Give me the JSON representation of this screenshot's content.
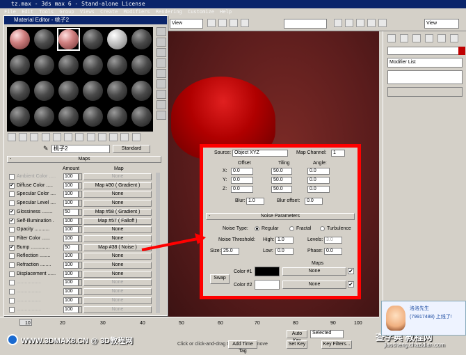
{
  "window": {
    "title": "tz.max - 3ds max 6 - Stand-alone License"
  },
  "menu": [
    "File",
    "Edit",
    "Tools",
    "Group",
    "Views",
    "Create",
    "Modifiers",
    "Rendering",
    "Customize",
    "Help"
  ],
  "toolbar": {
    "view1": "View",
    "view2": "View",
    "view3": "View"
  },
  "command_panel": {
    "modifier_list": "Modifier List"
  },
  "material_editor": {
    "title": "Material Editor - 桃子2",
    "material_name": "桃子2",
    "type_button": "Standard",
    "maps_header": "Maps",
    "col_amount": "Amount",
    "col_map": "Map",
    "rows": [
      {
        "name": "Ambient Color .....",
        "amount": "100",
        "map": "None",
        "checked": false,
        "dim": true
      },
      {
        "name": "Diffuse Color .....",
        "amount": "100",
        "map": "Map #30 ( Gradient )",
        "checked": true,
        "dim": false
      },
      {
        "name": "Specular Color ....",
        "amount": "100",
        "map": "None",
        "checked": false,
        "dim": false
      },
      {
        "name": "Specular Level ....",
        "amount": "100",
        "map": "None",
        "checked": false,
        "dim": false
      },
      {
        "name": "Glossiness ........",
        "amount": "50",
        "map": "Map #58 ( Gradient )",
        "checked": true,
        "dim": false
      },
      {
        "name": "Self-Illumination .",
        "amount": "100",
        "map": "Map #57 ( Falloff )",
        "checked": true,
        "dim": false
      },
      {
        "name": "Opacity ...........",
        "amount": "100",
        "map": "None",
        "checked": false,
        "dim": false
      },
      {
        "name": "Filter Color ......",
        "amount": "100",
        "map": "None",
        "checked": false,
        "dim": false
      },
      {
        "name": "Bump ..............",
        "amount": "50",
        "map": "Map #38 ( Noise )",
        "checked": true,
        "dim": false
      },
      {
        "name": "Reflection ........",
        "amount": "100",
        "map": "None",
        "checked": false,
        "dim": false
      },
      {
        "name": "Refraction ........",
        "amount": "100",
        "map": "None",
        "checked": false,
        "dim": false
      },
      {
        "name": "Displacement ......",
        "amount": "100",
        "map": "None",
        "checked": false,
        "dim": false
      },
      {
        "name": "..................",
        "amount": "100",
        "map": "None",
        "checked": false,
        "dim": true
      },
      {
        "name": "..................",
        "amount": "100",
        "map": "None",
        "checked": false,
        "dim": true
      },
      {
        "name": "..................",
        "amount": "100",
        "map": "None",
        "checked": false,
        "dim": true
      },
      {
        "name": "..................",
        "amount": "100",
        "map": "None",
        "checked": false,
        "dim": true
      }
    ]
  },
  "noise_panel": {
    "source_label": "Source:",
    "source_value": "Object XYZ",
    "map_channel_label": "Map Channel:",
    "map_channel_value": "1",
    "offset_label": "Offset",
    "tiling_label": "Tiling",
    "angle_label": "Angle:",
    "x_label": "X:",
    "y_label": "Y:",
    "z_label": "Z:",
    "offset": [
      "0.0",
      "0.0",
      "0.0"
    ],
    "tiling": [
      "50.0",
      "50.0",
      "50.0"
    ],
    "angle": [
      "0.0",
      "0.0",
      "0.0"
    ],
    "blur_label": "Blur:",
    "blur": "1.0",
    "blur_offset_label": "Blur offset:",
    "blur_offset": "0.0",
    "params_header": "Noise Parameters",
    "noise_type_label": "Noise Type:",
    "type_regular": "Regular",
    "type_fractal": "Fractal",
    "type_turbulence": "Turbulence",
    "threshold_label": "Noise Threshold:",
    "high_label": "High:",
    "high": "1.0",
    "levels_label": "Levels:",
    "levels": "3.0",
    "size_label": "Size:",
    "size": "25.0",
    "low_label": "Low:",
    "low": "0.0",
    "phase_label": "Phase:",
    "phase": "0.0",
    "maps_label": "Maps",
    "color1_label": "Color #1",
    "color2_label": "Color #2",
    "swap_label": "Swap",
    "none1": "None",
    "none2": "None",
    "color1": "#000000",
    "color2": "#ffffff"
  },
  "timeline": {
    "ticks": [
      "10",
      "20",
      "30",
      "40",
      "50",
      "60",
      "70",
      "80",
      "90",
      "100"
    ]
  },
  "status": {
    "prompt": "Click or click-and-drag to select and move",
    "add_time_tag": "Add Time Tag",
    "auto_key": "Auto Key",
    "set_key": "Set Key",
    "selected": "Selected",
    "key_filters": "Key Filters..."
  },
  "watermark": {
    "left": "WWW.3DMAX8.CN @ 3D教程网",
    "right_site": "查字典 教程网",
    "right_url": "jiaocheng.chazidian.com"
  },
  "notify": {
    "line1": "洛洛先生",
    "line2": "(79917488) 上线了!"
  },
  "colors": {
    "highlight_border": "#ff0000",
    "titlebar": "#0a246a"
  }
}
